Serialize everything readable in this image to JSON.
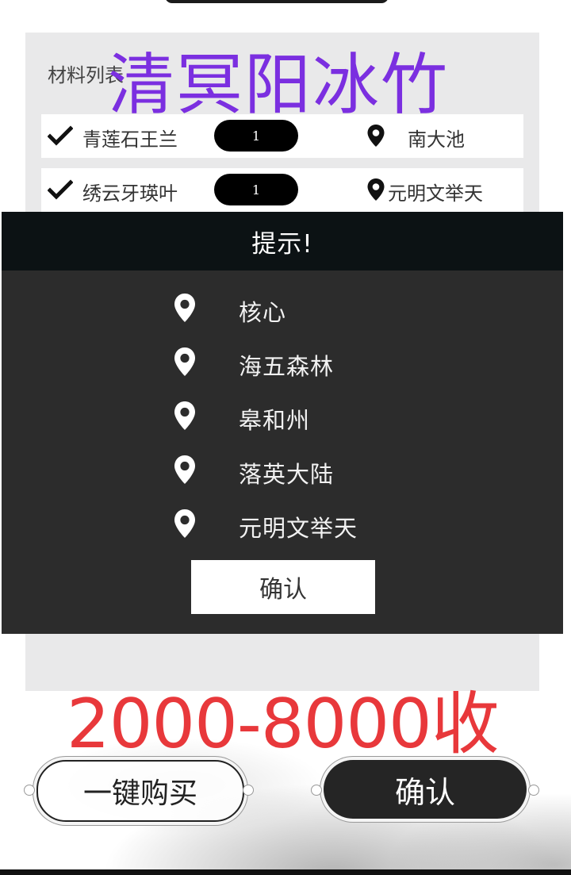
{
  "panel": {
    "title": "材料列表",
    "watermark": "清冥阳冰竹"
  },
  "materials": [
    {
      "name": "青莲石王兰",
      "qty": "1",
      "location": "南大池"
    },
    {
      "name": "绣云牙瑛叶",
      "qty": "1",
      "location": "元明文举天"
    }
  ],
  "dialog": {
    "title": "提示!",
    "options": [
      "核心",
      "海五森林",
      "皋和州",
      "落英大陆",
      "元明文举天"
    ],
    "confirm_label": "确认"
  },
  "price_text": "2000-8000收",
  "actions": {
    "buy_all_label": "一键购买",
    "confirm_label": "确认"
  },
  "icons": {
    "check": "check-icon",
    "pin": "map-pin-icon"
  },
  "colors": {
    "watermark": "#7b2fe0",
    "price": "#e8383b",
    "modal_bg": "#2c2c2c",
    "modal_header": "#0c1214"
  }
}
